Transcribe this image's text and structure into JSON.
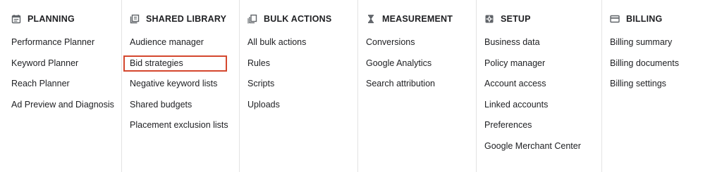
{
  "columns": [
    {
      "title": "PLANNING",
      "icon": "planner-icon",
      "items": [
        "Performance Planner",
        "Keyword Planner",
        "Reach Planner",
        "Ad Preview and Diagnosis"
      ]
    },
    {
      "title": "SHARED LIBRARY",
      "icon": "library-icon",
      "items": [
        "Audience manager",
        "Bid strategies",
        "Negative keyword lists",
        "Shared budgets",
        "Placement exclusion lists"
      ],
      "highlighted_item": "Bid strategies"
    },
    {
      "title": "BULK ACTIONS",
      "icon": "bulk-actions-icon",
      "items": [
        "All bulk actions",
        "Rules",
        "Scripts",
        "Uploads"
      ]
    },
    {
      "title": "MEASUREMENT",
      "icon": "hourglass-icon",
      "items": [
        "Conversions",
        "Google Analytics",
        "Search attribution"
      ]
    },
    {
      "title": "SETUP",
      "icon": "gear-icon",
      "items": [
        "Business data",
        "Policy manager",
        "Account access",
        "Linked accounts",
        "Preferences",
        "Google Merchant Center"
      ]
    },
    {
      "title": "BILLING",
      "icon": "credit-card-icon",
      "items": [
        "Billing summary",
        "Billing documents",
        "Billing settings"
      ]
    }
  ],
  "colors": {
    "text": "#202124",
    "icon": "#5f6368",
    "divider": "#e3e3e3",
    "highlight_border": "#d4472e"
  }
}
